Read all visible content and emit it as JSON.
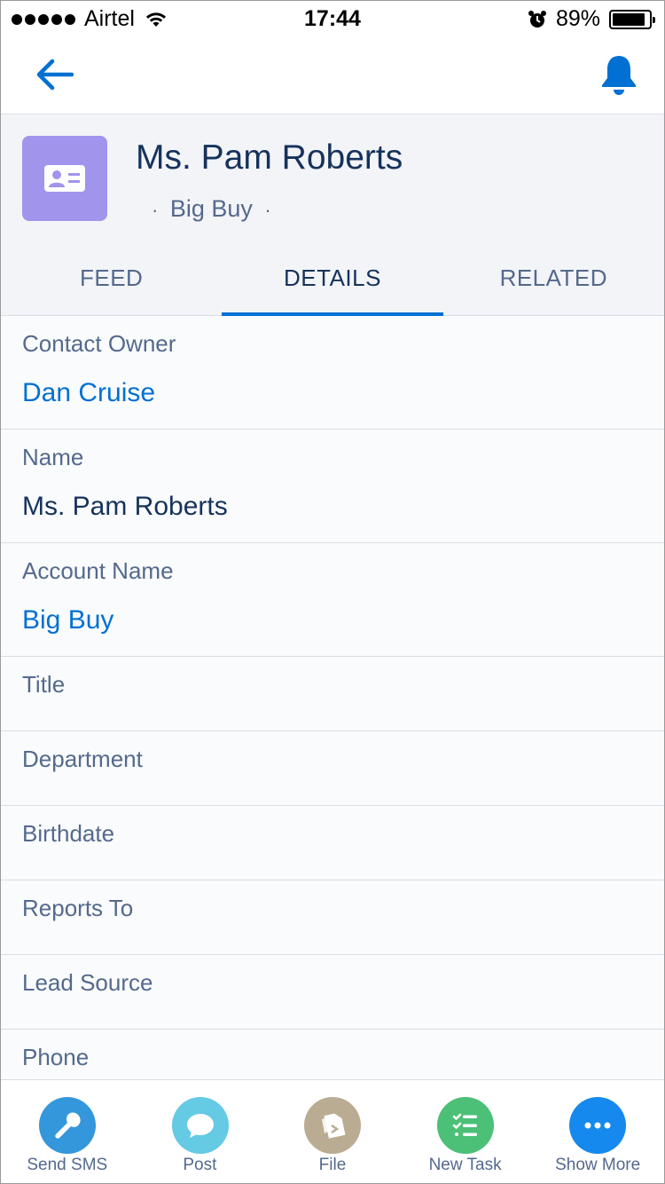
{
  "status_bar": {
    "carrier": "Airtel",
    "time": "17:44",
    "battery": "89%",
    "battery_level": 0.89
  },
  "navbar": {
    "back_icon": "back-arrow-icon",
    "notifications_icon": "bell-icon"
  },
  "record": {
    "icon": "contact-card-icon",
    "icon_color": "#a094ed",
    "title": "Ms. Pam Roberts",
    "subtitle_separator": "·",
    "subtitle": "Big Buy"
  },
  "tabs": [
    {
      "label": "FEED",
      "active": false
    },
    {
      "label": "DETAILS",
      "active": true
    },
    {
      "label": "RELATED",
      "active": false
    }
  ],
  "fields": [
    {
      "label": "Contact Owner",
      "value": "Dan Cruise",
      "link": true
    },
    {
      "label": "Name",
      "value": "Ms. Pam Roberts",
      "link": false
    },
    {
      "label": "Account Name",
      "value": "Big Buy",
      "link": true
    },
    {
      "label": "Title",
      "value": ""
    },
    {
      "label": "Department",
      "value": ""
    },
    {
      "label": "Birthdate",
      "value": ""
    },
    {
      "label": "Reports To",
      "value": ""
    },
    {
      "label": "Lead Source",
      "value": ""
    },
    {
      "label": "Phone",
      "value": ""
    }
  ],
  "actions": [
    {
      "label": "Send SMS",
      "icon": "wrench-icon",
      "color": "#3497db"
    },
    {
      "label": "Post",
      "icon": "chat-bubble-icon",
      "color": "#65cae4"
    },
    {
      "label": "File",
      "icon": "file-icon",
      "color": "#baac93"
    },
    {
      "label": "New Task",
      "icon": "task-list-icon",
      "color": "#4bc076"
    },
    {
      "label": "Show More",
      "icon": "more-dots-icon",
      "color": "#1589ee"
    }
  ],
  "colors": {
    "brand": "#0070d2",
    "text_dark": "#16325c",
    "text_label": "#54698d"
  }
}
